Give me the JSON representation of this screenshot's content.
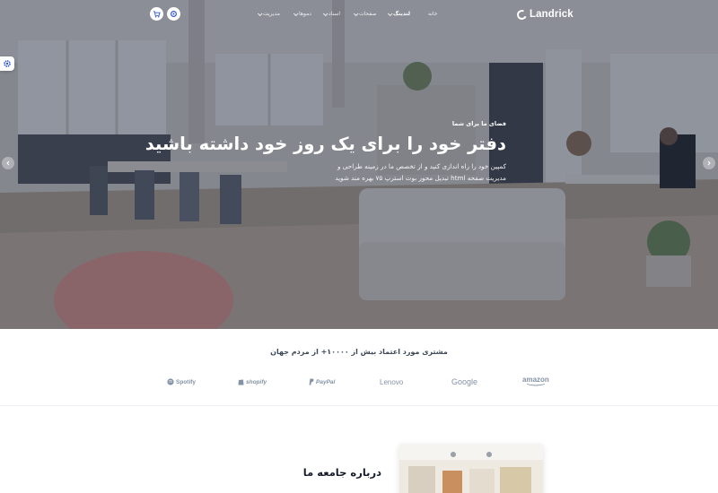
{
  "header": {
    "logo_text": "Landrick",
    "nav": [
      {
        "label": "خانه",
        "active": false,
        "dropdown": false
      },
      {
        "label": "لندینگ",
        "active": true,
        "dropdown": true
      },
      {
        "label": "صفحات",
        "active": false,
        "dropdown": true
      },
      {
        "label": "اسناد",
        "active": false,
        "dropdown": true
      },
      {
        "label": "دموها",
        "active": false,
        "dropdown": true
      },
      {
        "label": "مدیریت",
        "active": false,
        "dropdown": true
      }
    ],
    "icons": [
      "settings-icon",
      "cart-icon"
    ]
  },
  "hero": {
    "eyebrow": "فضای ما برای شما",
    "title": "دفتر خود را برای یک روز خود داشته باشید",
    "description": "کمپین خود را راه اندازی کنید و از تخصص ما در زمینه طراحی و مدیریت صفحه html تبدیل محور بوت استرپ ۷۵ بهره مند شوید"
  },
  "clients": {
    "title": "مشتری مورد اعتماد بیش از ۱۰۰۰۰+ از مردم جهان",
    "brands": [
      "Spotify",
      "shopify",
      "PayPal",
      "Lenovo",
      "Google",
      "amazon"
    ]
  },
  "about": {
    "title": "درباره جامعه ما"
  },
  "colors": {
    "primary": "#2f55d4",
    "overlay": "#262d46",
    "heading": "#161c2d",
    "muted": "#8492a6"
  }
}
